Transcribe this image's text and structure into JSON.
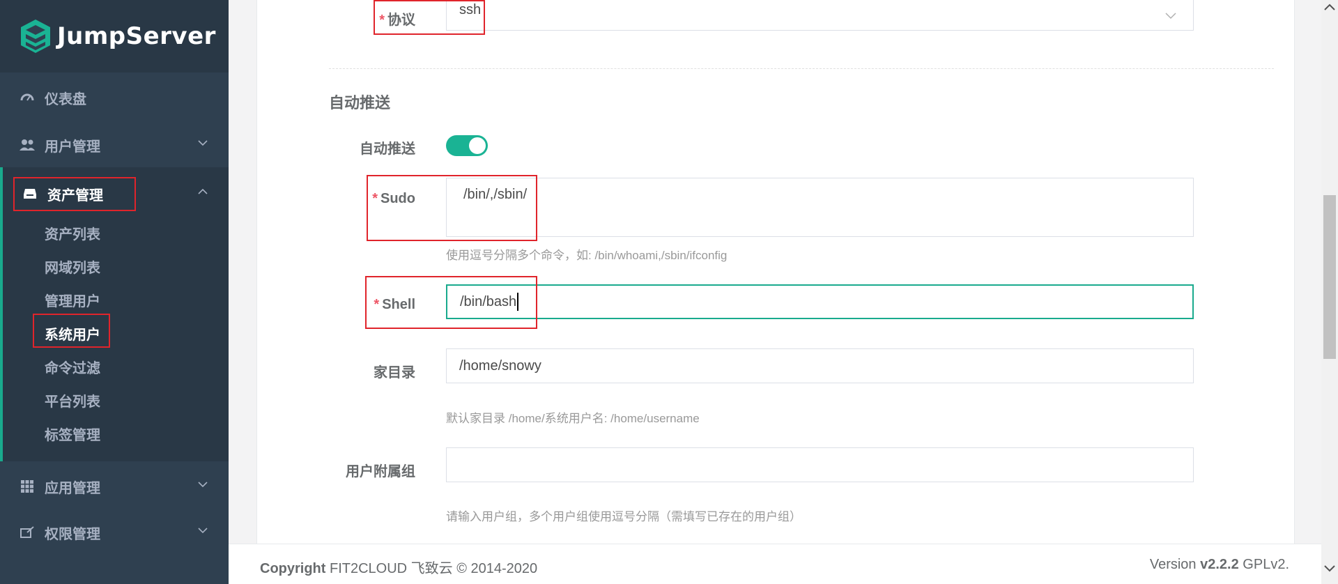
{
  "brand": {
    "name": "JumpServer"
  },
  "sidebar": {
    "items": [
      {
        "label": "仪表盘",
        "icon": "dashboard-icon"
      },
      {
        "label": "用户管理",
        "icon": "users-icon"
      },
      {
        "label": "资产管理",
        "icon": "inbox-icon",
        "active": true
      },
      {
        "label": "应用管理",
        "icon": "grid-icon"
      },
      {
        "label": "权限管理",
        "icon": "permission-icon"
      }
    ],
    "asset_sub": [
      "资产列表",
      "网域列表",
      "管理用户",
      "系统用户",
      "命令过滤",
      "平台列表",
      "标签管理"
    ],
    "active_sub": "系统用户"
  },
  "form": {
    "protocol": {
      "label": "协议",
      "value": "ssh"
    },
    "auto_push_section": "自动推送",
    "auto_push": {
      "label": "自动推送",
      "enabled": true
    },
    "sudo": {
      "label": "Sudo",
      "value": "/bin/,/sbin/",
      "hint": "使用逗号分隔多个命令，如: /bin/whoami,/sbin/ifconfig"
    },
    "shell": {
      "label": "Shell",
      "value": "/bin/bash"
    },
    "home": {
      "label": "家目录",
      "value": "/home/snowy",
      "hint": "默认家目录 /home/系统用户名: /home/username"
    },
    "groups": {
      "label": "用户附属组",
      "value": "",
      "hint": "请输入用户组，多个用户组使用逗号分隔（需填写已存在的用户组）"
    }
  },
  "required_mark": "*",
  "footer": {
    "copyright_label": "Copyright",
    "copyright_text": "FIT2CLOUD 飞致云 © 2014-2020",
    "version_label": "Version",
    "version_number": "v2.2.2",
    "license": "GPLv2."
  },
  "colors": {
    "accent": "#1ab394",
    "sidebar": "#2f4050",
    "highlight": "#e0242b"
  }
}
